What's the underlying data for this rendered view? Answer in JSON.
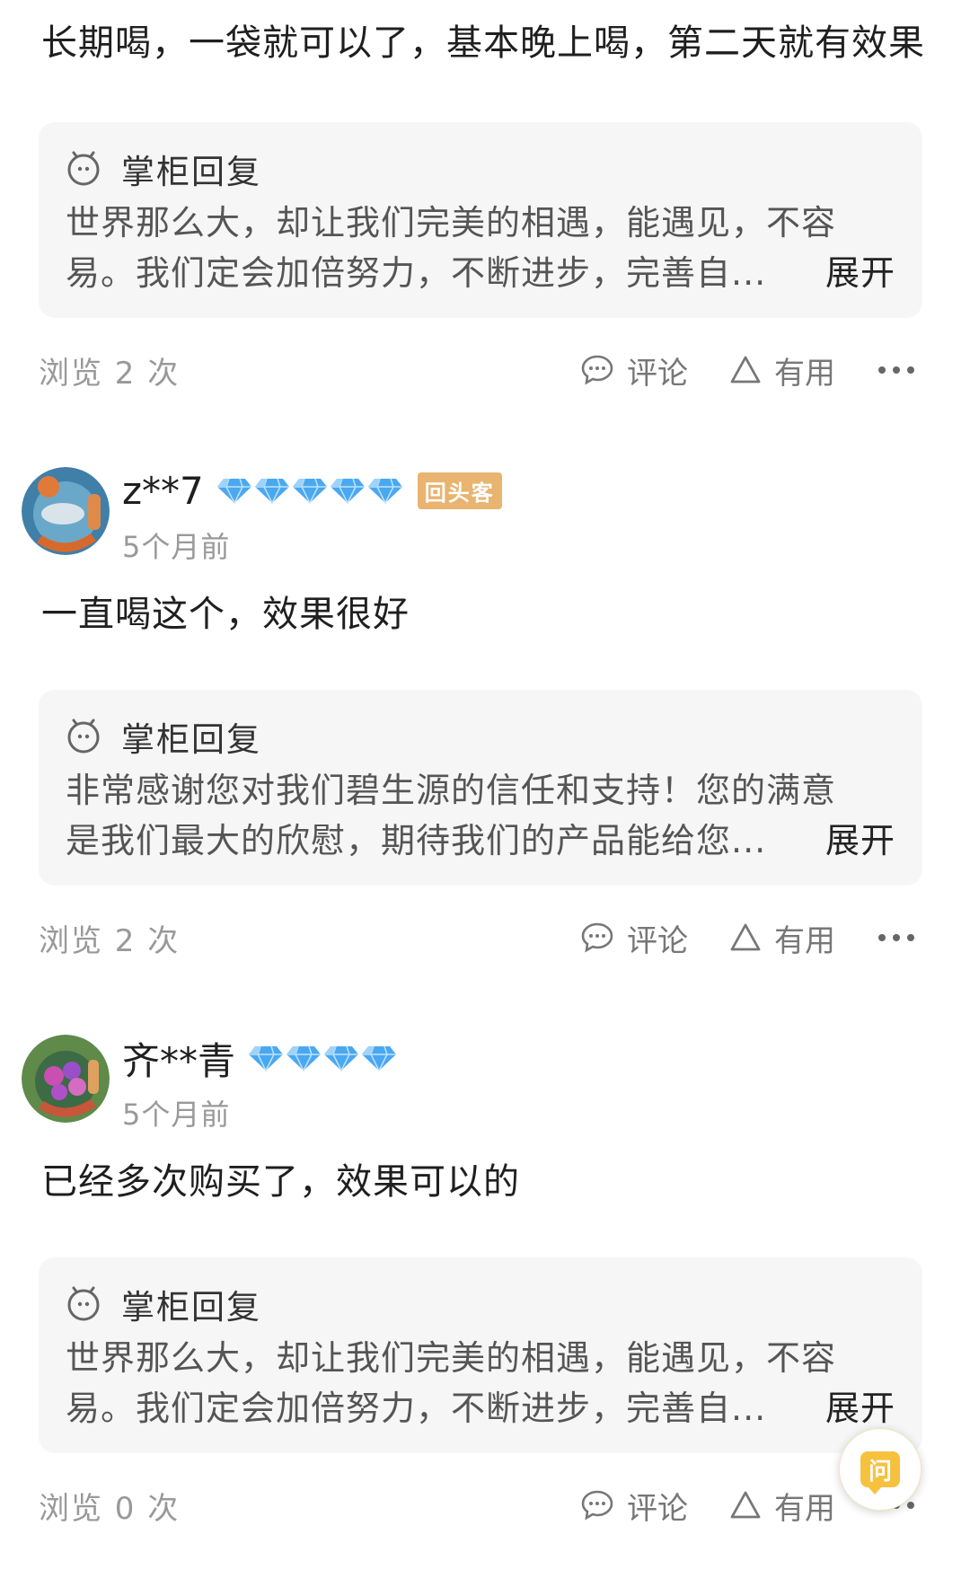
{
  "reviews": [
    {
      "text": "长期喝，一袋就可以了，基本晚上喝，第二天就有效果",
      "reply": {
        "label": "掌柜回复",
        "line1": "世界那么大，却让我们完美的相遇，能遇见，不容",
        "line2": "易。我们定会加倍努力，不断进步，完善自...",
        "expand": "展开"
      },
      "views": "浏览 2 次",
      "comment_label": "评论",
      "useful_label": "有用"
    },
    {
      "user": {
        "name": "z**7",
        "diamonds": 5,
        "badge": "回头客",
        "time": "5个月前"
      },
      "text": "一直喝这个，效果很好",
      "reply": {
        "label": "掌柜回复",
        "line1": "非常感谢您对我们碧生源的信任和支持！您的满意",
        "line2": "是我们最大的欣慰，期待我们的产品能给您...",
        "expand": "展开"
      },
      "views": "浏览 2 次",
      "comment_label": "评论",
      "useful_label": "有用"
    },
    {
      "user": {
        "name": "齐**青",
        "diamonds": 4,
        "time": "5个月前"
      },
      "text": "已经多次购买了，效果可以的",
      "reply": {
        "label": "掌柜回复",
        "line1": "世界那么大，却让我们完美的相遇，能遇见，不容",
        "line2": "易。我们定会加倍努力，不断进步，完善自...",
        "expand": "展开"
      },
      "views": "浏览 0 次",
      "comment_label": "评论",
      "useful_label": "有用"
    }
  ],
  "ask_button": {
    "label": "问"
  },
  "colors": {
    "diamond": "#4aa8f0",
    "badge": "#e9b46f",
    "fab": "#f6c23e"
  }
}
